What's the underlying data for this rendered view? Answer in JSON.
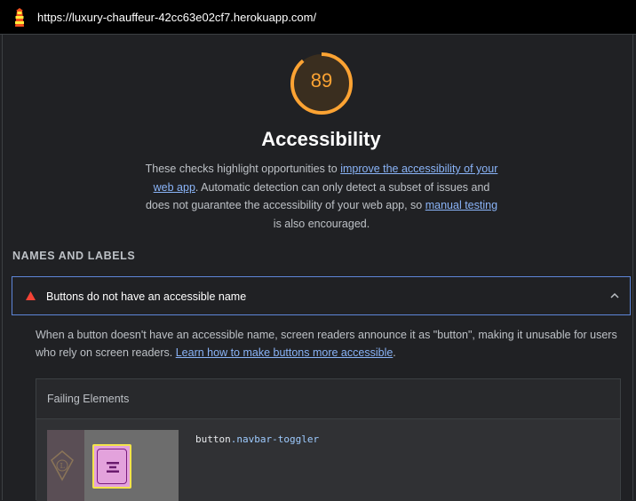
{
  "url": "https://luxury-chauffeur-42cc63e02cf7.herokuapp.com/",
  "score": "89",
  "score_fraction": 0.89,
  "colors": {
    "score_orange": "#fca333",
    "link_blue": "#8ab4f8",
    "warn_red": "#f44336",
    "focus_border": "#5e86d8"
  },
  "category": {
    "title": "Accessibility",
    "desc_before": "These checks highlight opportunities to ",
    "desc_link1": "improve the accessibility of your web app",
    "desc_middle": ". Automatic detection can only detect a subset of issues and does not guarantee the accessibility of your web app, so ",
    "desc_link2": "manual testing",
    "desc_after": " is also encouraged."
  },
  "group_title": "NAMES AND LABELS",
  "audit": {
    "title": "Buttons do not have an accessible name",
    "status_icon": "warning-triangle-icon",
    "toggle_icon": "chevron-up-icon",
    "desc_before": "When a button doesn't have an accessible name, screen readers announce it as \"button\", making it unusable for users who rely on screen readers. ",
    "desc_link": "Learn how to make buttons more accessible",
    "desc_after": "."
  },
  "failing": {
    "header": "Failing Elements",
    "items": [
      {
        "selector_tag": "button",
        "selector_class": ".navbar-toggler",
        "thumbnail_icon": "hamburger-menu-icon"
      }
    ]
  }
}
